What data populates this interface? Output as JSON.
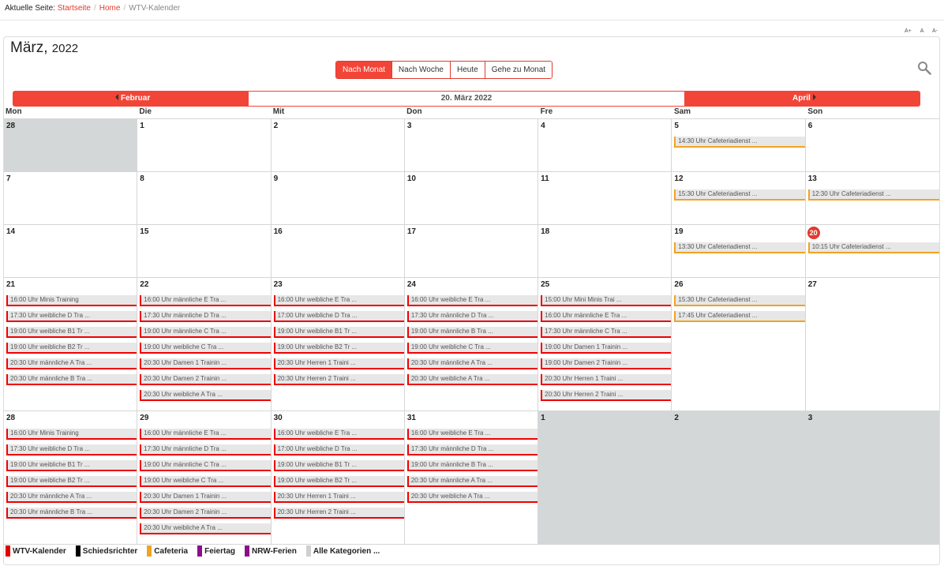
{
  "breadcrumb": {
    "prefix": "Aktuelle Seite:",
    "items": [
      "Startseite",
      "Home"
    ],
    "current": "WTV-Kalender"
  },
  "font_controls": [
    "A+",
    "A",
    "A-"
  ],
  "header": {
    "month": "März,",
    "year": "2022"
  },
  "view_buttons": [
    "Nach Monat",
    "Nach Woche",
    "Heute",
    "Gehe zu Monat"
  ],
  "nav": {
    "prev": "Februar",
    "current": "20. März 2022",
    "next": "April"
  },
  "weekdays": [
    "Mon",
    "Die",
    "Mit",
    "Don",
    "Fre",
    "Sam",
    "Son"
  ],
  "colors": {
    "accent": "#f24537",
    "wtv": "#e00000",
    "cafeteria": "#f0a323"
  },
  "weeks": [
    {
      "tall": false,
      "days": [
        {
          "num": "28",
          "other": true,
          "events": []
        },
        {
          "num": "1",
          "events": []
        },
        {
          "num": "2",
          "events": []
        },
        {
          "num": "3",
          "events": []
        },
        {
          "num": "4",
          "events": []
        },
        {
          "num": "5",
          "events": [
            {
              "t": "14:30 Uhr Cafeteriadienst ...",
              "c": "orange"
            }
          ]
        },
        {
          "num": "6",
          "events": []
        }
      ]
    },
    {
      "tall": false,
      "days": [
        {
          "num": "7",
          "events": []
        },
        {
          "num": "8",
          "events": []
        },
        {
          "num": "9",
          "events": []
        },
        {
          "num": "10",
          "events": []
        },
        {
          "num": "11",
          "events": []
        },
        {
          "num": "12",
          "events": [
            {
              "t": "15:30 Uhr Cafeteriadienst ...",
              "c": "orange"
            }
          ]
        },
        {
          "num": "13",
          "events": [
            {
              "t": "12:30 Uhr Cafeteriadienst ...",
              "c": "orange"
            }
          ]
        }
      ]
    },
    {
      "tall": false,
      "days": [
        {
          "num": "14",
          "events": []
        },
        {
          "num": "15",
          "events": []
        },
        {
          "num": "16",
          "events": []
        },
        {
          "num": "17",
          "events": []
        },
        {
          "num": "18",
          "events": []
        },
        {
          "num": "19",
          "events": [
            {
              "t": "13:30 Uhr Cafeteriadienst ...",
              "c": "orange"
            }
          ]
        },
        {
          "num": "20",
          "today": true,
          "events": [
            {
              "t": "10:15 Uhr Cafeteriadienst ...",
              "c": "orange"
            }
          ]
        }
      ]
    },
    {
      "tall": true,
      "days": [
        {
          "num": "21",
          "events": [
            {
              "t": "16:00 Uhr Minis Training",
              "c": "red"
            },
            {
              "t": "17:30 Uhr weibliche D Tra ...",
              "c": "red"
            },
            {
              "t": "19:00 Uhr weibliche B1 Tr ...",
              "c": "red"
            },
            {
              "t": "19:00 Uhr weibliche B2 Tr ...",
              "c": "red"
            },
            {
              "t": "20:30 Uhr männliche A Tra ...",
              "c": "red"
            },
            {
              "t": "20:30 Uhr männliche B Tra ...",
              "c": "red"
            }
          ]
        },
        {
          "num": "22",
          "events": [
            {
              "t": "16:00 Uhr männliche E Tra ...",
              "c": "red"
            },
            {
              "t": "17:30 Uhr männliche D Tra ...",
              "c": "red"
            },
            {
              "t": "19:00 Uhr männliche C Tra ...",
              "c": "red"
            },
            {
              "t": "19:00 Uhr weibliche C Tra ...",
              "c": "red"
            },
            {
              "t": "20:30 Uhr Damen 1 Trainin ...",
              "c": "red"
            },
            {
              "t": "20:30 Uhr Damen 2 Trainin ...",
              "c": "red"
            },
            {
              "t": "20:30 Uhr weibliche A Tra ...",
              "c": "red"
            }
          ]
        },
        {
          "num": "23",
          "events": [
            {
              "t": "16:00 Uhr weibliche E Tra ...",
              "c": "red"
            },
            {
              "t": "17:00 Uhr weibliche D Tra ...",
              "c": "red"
            },
            {
              "t": "19:00 Uhr weibliche B1 Tr ...",
              "c": "red"
            },
            {
              "t": "19:00 Uhr weibliche B2 Tr ...",
              "c": "red"
            },
            {
              "t": "20:30 Uhr Herren 1 Traini ...",
              "c": "red"
            },
            {
              "t": "20:30 Uhr Herren 2 Traini ...",
              "c": "red"
            }
          ]
        },
        {
          "num": "24",
          "events": [
            {
              "t": "16:00 Uhr weibliche E Tra ...",
              "c": "red"
            },
            {
              "t": "17:30 Uhr männliche D Tra ...",
              "c": "red"
            },
            {
              "t": "19:00 Uhr männliche B Tra ...",
              "c": "red"
            },
            {
              "t": "19:00 Uhr weibliche C Tra ...",
              "c": "red"
            },
            {
              "t": "20:30 Uhr männliche A Tra ...",
              "c": "red"
            },
            {
              "t": "20:30 Uhr weibliche A Tra ...",
              "c": "red"
            }
          ]
        },
        {
          "num": "25",
          "events": [
            {
              "t": "15:00 Uhr Mini Minis Trai ...",
              "c": "red"
            },
            {
              "t": "16:00 Uhr männliche E Tra ...",
              "c": "red"
            },
            {
              "t": "17:30 Uhr männliche C Tra ...",
              "c": "red"
            },
            {
              "t": "19:00 Uhr Damen 1 Trainin ...",
              "c": "red"
            },
            {
              "t": "19:00 Uhr Damen 2 Trainin ...",
              "c": "red"
            },
            {
              "t": "20:30 Uhr Herren 1 Traini ...",
              "c": "red"
            },
            {
              "t": "20:30 Uhr Herren 2 Traini ...",
              "c": "red"
            }
          ]
        },
        {
          "num": "26",
          "events": [
            {
              "t": "15:30 Uhr Cafeteriadienst ...",
              "c": "orange"
            },
            {
              "t": "17:45 Uhr Cafeteriadienst ...",
              "c": "orange"
            }
          ]
        },
        {
          "num": "27",
          "events": []
        }
      ]
    },
    {
      "tall": true,
      "days": [
        {
          "num": "28",
          "events": [
            {
              "t": "16:00 Uhr Minis Training",
              "c": "red"
            },
            {
              "t": "17:30 Uhr weibliche D Tra ...",
              "c": "red"
            },
            {
              "t": "19:00 Uhr weibliche B1 Tr ...",
              "c": "red"
            },
            {
              "t": "19:00 Uhr weibliche B2 Tr ...",
              "c": "red"
            },
            {
              "t": "20:30 Uhr männliche A Tra ...",
              "c": "red"
            },
            {
              "t": "20:30 Uhr männliche B Tra ...",
              "c": "red"
            }
          ]
        },
        {
          "num": "29",
          "events": [
            {
              "t": "16:00 Uhr männliche E Tra ...",
              "c": "red"
            },
            {
              "t": "17:30 Uhr männliche D Tra ...",
              "c": "red"
            },
            {
              "t": "19:00 Uhr männliche C Tra ...",
              "c": "red"
            },
            {
              "t": "19:00 Uhr weibliche C Tra ...",
              "c": "red"
            },
            {
              "t": "20:30 Uhr Damen 1 Trainin ...",
              "c": "red"
            },
            {
              "t": "20:30 Uhr Damen 2 Trainin ...",
              "c": "red"
            },
            {
              "t": "20:30 Uhr weibliche A Tra ...",
              "c": "red"
            }
          ]
        },
        {
          "num": "30",
          "events": [
            {
              "t": "16:00 Uhr weibliche E Tra ...",
              "c": "red"
            },
            {
              "t": "17:00 Uhr weibliche D Tra ...",
              "c": "red"
            },
            {
              "t": "19:00 Uhr weibliche B1 Tr ...",
              "c": "red"
            },
            {
              "t": "19:00 Uhr weibliche B2 Tr ...",
              "c": "red"
            },
            {
              "t": "20:30 Uhr Herren 1 Traini ...",
              "c": "red"
            },
            {
              "t": "20:30 Uhr Herren 2 Traini ...",
              "c": "red"
            }
          ]
        },
        {
          "num": "31",
          "events": [
            {
              "t": "16:00 Uhr weibliche E Tra ...",
              "c": "red"
            },
            {
              "t": "17:30 Uhr männliche D Tra ...",
              "c": "red"
            },
            {
              "t": "19:00 Uhr männliche B Tra ...",
              "c": "red"
            },
            {
              "t": "20:30 Uhr männliche A Tra ...",
              "c": "red"
            },
            {
              "t": "20:30 Uhr weibliche A Tra ...",
              "c": "red"
            }
          ]
        },
        {
          "num": "1",
          "other": true,
          "events": []
        },
        {
          "num": "2",
          "other": true,
          "events": []
        },
        {
          "num": "3",
          "other": true,
          "events": []
        }
      ]
    }
  ],
  "legend": [
    {
      "label": "WTV-Kalender",
      "color": "#e00000"
    },
    {
      "label": "Schiedsrichter",
      "color": "#000000"
    },
    {
      "label": "Cafeteria",
      "color": "#f0a323"
    },
    {
      "label": "Feiertag",
      "color": "#8b0f8b"
    },
    {
      "label": "NRW-Ferien",
      "color": "#8b0f8b"
    },
    {
      "label": "Alle Kategorien ...",
      "color": "#cfcfcf"
    }
  ]
}
